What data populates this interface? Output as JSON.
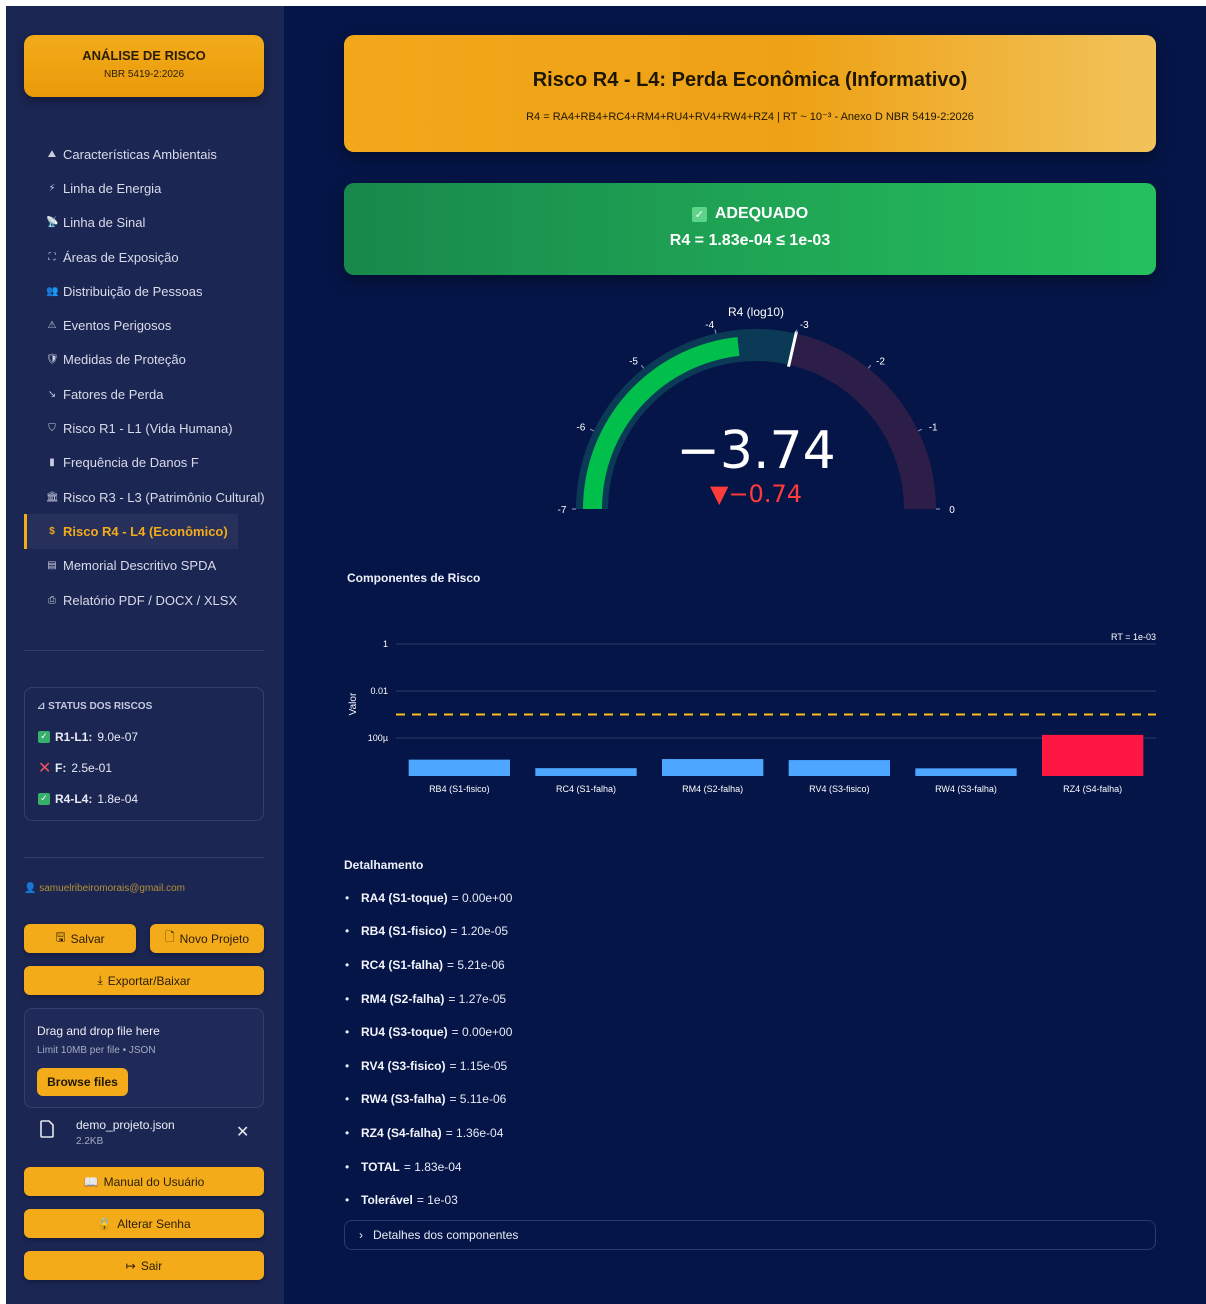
{
  "brand": {
    "title": "ANÁLISE DE RISCO",
    "subtitle": "NBR 5419-2:2026"
  },
  "nav": [
    {
      "icon": "⛰",
      "label": "Características Ambientais"
    },
    {
      "icon": "⚡",
      "label": "Linha de Energia"
    },
    {
      "icon": "📡",
      "label": "Linha de Sinal"
    },
    {
      "icon": "⛶",
      "label": "Áreas de Exposição"
    },
    {
      "icon": "👥",
      "label": "Distribuição de Pessoas"
    },
    {
      "icon": "⚠",
      "label": "Eventos Perigosos"
    },
    {
      "icon": "🛡",
      "label": "Medidas de Proteção"
    },
    {
      "icon": "↘",
      "label": "Fatores de Perda"
    },
    {
      "icon": "⛉",
      "label": "Risco R1 - L1 (Vida Humana)"
    },
    {
      "icon": "▮",
      "label": "Frequência de Danos F"
    },
    {
      "icon": "🏛",
      "label": "Risco R3 - L3 (Patrimônio Cultural)"
    },
    {
      "icon": "$",
      "label": "Risco R4 - L4 (Econômico)"
    },
    {
      "icon": "▤",
      "label": "Memorial Descritivo SPDA"
    },
    {
      "icon": "⎙",
      "label": "Relatório PDF / DOCX / XLSX"
    }
  ],
  "status_panel": {
    "title": "STATUS DOS RISCOS",
    "rows": [
      {
        "label": "R1-L1:",
        "value": "9.0e-07",
        "ok": true
      },
      {
        "label": "F:",
        "value": "2.5e-01",
        "ok": false
      },
      {
        "label": "R4-L4:",
        "value": "1.8e-04",
        "ok": true
      }
    ]
  },
  "user_email": "samuelribeiromorais@gmail.com",
  "buttons": {
    "save": "Salvar",
    "new_project": "Novo Projeto",
    "export": "Exportar/Baixar",
    "manual": "Manual do Usuário",
    "change_password": "Alterar Senha",
    "logout": "Sair"
  },
  "uploader": {
    "title": "Drag and drop file here",
    "limit": "Limit 10MB per file • JSON",
    "browse": "Browse files",
    "file_name": "demo_projeto.json",
    "file_size": "2.2KB"
  },
  "header": {
    "title": "Risco R4 - L4: Perda Econômica (Informativo)",
    "subtitle": "R4 = RA4+RB4+RC4+RM4+RU4+RV4+RW4+RZ4 | RT ~ 10⁻³ - Anexo D NBR 5419-2:2026"
  },
  "result": {
    "status": "ADEQUADO",
    "formula": "R4 = 1.83e-04 ≤ 1e-03"
  },
  "gauge": {
    "title": "R4 (log10)",
    "value": -3.74,
    "value_text": "−3.74",
    "delta_text": "▼−0.74",
    "threshold": -3,
    "min": -7,
    "max": 0,
    "ticks": [
      "-7",
      "-6",
      "-5",
      "-4",
      "-3",
      "-2",
      "-1",
      "0"
    ],
    "colors": {
      "fill": "#00c04b",
      "track": "#0a3a55",
      "bg": "#2c1e48"
    }
  },
  "chart_section_title": "Componentes de Risco",
  "chart_data": {
    "type": "bar",
    "categories": [
      "RB4 (S1-fisico)",
      "RC4 (S1-falha)",
      "RM4 (S2-falha)",
      "RV4 (S3-fisico)",
      "RW4 (S3-falha)",
      "RZ4 (S4-falha)"
    ],
    "values": [
      1.2e-05,
      5.21e-06,
      1.27e-05,
      1.15e-05,
      5.11e-06,
      0.000136
    ],
    "colors": [
      "#4da6ff",
      "#4da6ff",
      "#4da6ff",
      "#4da6ff",
      "#4da6ff",
      "#ff1744"
    ],
    "ylabel": "Valor",
    "yscale": "log",
    "ytick_labels": [
      "1",
      "0.01",
      "100µ"
    ],
    "yticks": [
      1,
      0.01,
      0.0001
    ],
    "threshold": 0.001,
    "threshold_label": "RT = 1e-03"
  },
  "detail": {
    "title": "Detalhamento",
    "items": [
      {
        "label": "RA4 (S1-toque)",
        "value": "= 0.00e+00"
      },
      {
        "label": "RB4 (S1-fisico)",
        "value": "= 1.20e-05"
      },
      {
        "label": "RC4 (S1-falha)",
        "value": "= 5.21e-06"
      },
      {
        "label": "RM4 (S2-falha)",
        "value": "= 1.27e-05"
      },
      {
        "label": "RU4 (S3-toque)",
        "value": "= 0.00e+00"
      },
      {
        "label": "RV4 (S3-fisico)",
        "value": "= 1.15e-05"
      },
      {
        "label": "RW4 (S3-falha)",
        "value": "= 5.11e-06"
      },
      {
        "label": "RZ4 (S4-falha)",
        "value": "= 1.36e-04"
      },
      {
        "label": "TOTAL",
        "value": "= 1.83e-04"
      },
      {
        "label": "Tolerável",
        "value": "= 1e-03"
      }
    ],
    "expander": "Detalhes dos componentes"
  }
}
